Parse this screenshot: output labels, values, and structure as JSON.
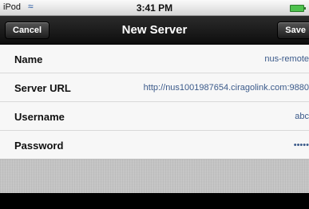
{
  "status_bar": {
    "carrier": "iPod",
    "wifi_icon": "wifi-icon",
    "time": "3:41 PM",
    "battery_icon": "battery-icon",
    "battery_color": "#4ec24e"
  },
  "nav": {
    "title": "New Server",
    "cancel_label": "Cancel",
    "save_label": "Save"
  },
  "form": {
    "rows": [
      {
        "label": "Name",
        "value": "nus-remote"
      },
      {
        "label": "Server URL",
        "value": "http://nus1001987654.ciragolink.com:9880"
      },
      {
        "label": "Username",
        "value": "abc"
      },
      {
        "label": "Password",
        "value": "•••••"
      }
    ]
  }
}
